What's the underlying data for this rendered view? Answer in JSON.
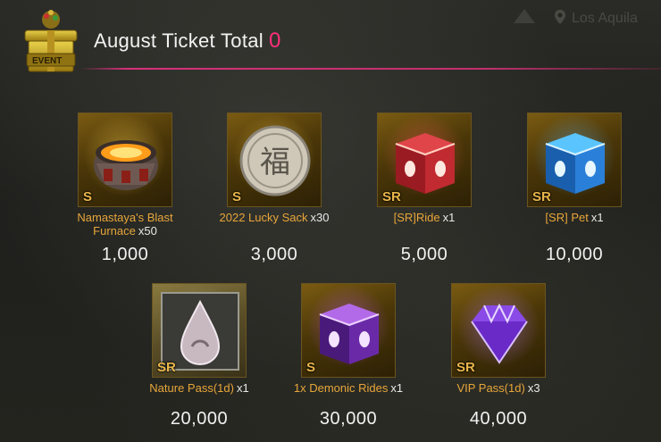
{
  "background": {
    "location_label": "Los Aquila"
  },
  "header": {
    "icon_label": "EVENT",
    "title": "August Ticket Total",
    "ticket_count": "0"
  },
  "rewards": [
    {
      "name": "Namastaya's Blast Furnace",
      "qty": "x50",
      "rarity": "S",
      "price": "1,000",
      "icon": "blast-furnace-icon"
    },
    {
      "name": "2022 Lucky Sack",
      "qty": "x30",
      "rarity": "S",
      "price": "3,000",
      "icon": "lucky-coin-icon"
    },
    {
      "name": "[SR]Ride",
      "qty": "x1",
      "rarity": "SR",
      "price": "5,000",
      "icon": "red-chest-icon"
    },
    {
      "name": "[SR] Pet",
      "qty": "x1",
      "rarity": "SR",
      "price": "10,000",
      "icon": "blue-chest-icon"
    },
    {
      "name": "Nature Pass(1d)",
      "qty": "x1",
      "rarity": "SR",
      "price": "20,000",
      "icon": "crystal-drop-icon"
    },
    {
      "name": "1x Demonic Rides",
      "qty": "x1",
      "rarity": "S",
      "price": "30,000",
      "icon": "purple-chest-icon"
    },
    {
      "name": "VIP Pass(1d)",
      "qty": "x3",
      "rarity": "SR",
      "price": "40,000",
      "icon": "purple-gem-icon"
    }
  ],
  "colors": {
    "accent_pink": "#ff2f7a",
    "name_gold": "#e7a63a",
    "rarity_gold": "#e9b64a"
  }
}
